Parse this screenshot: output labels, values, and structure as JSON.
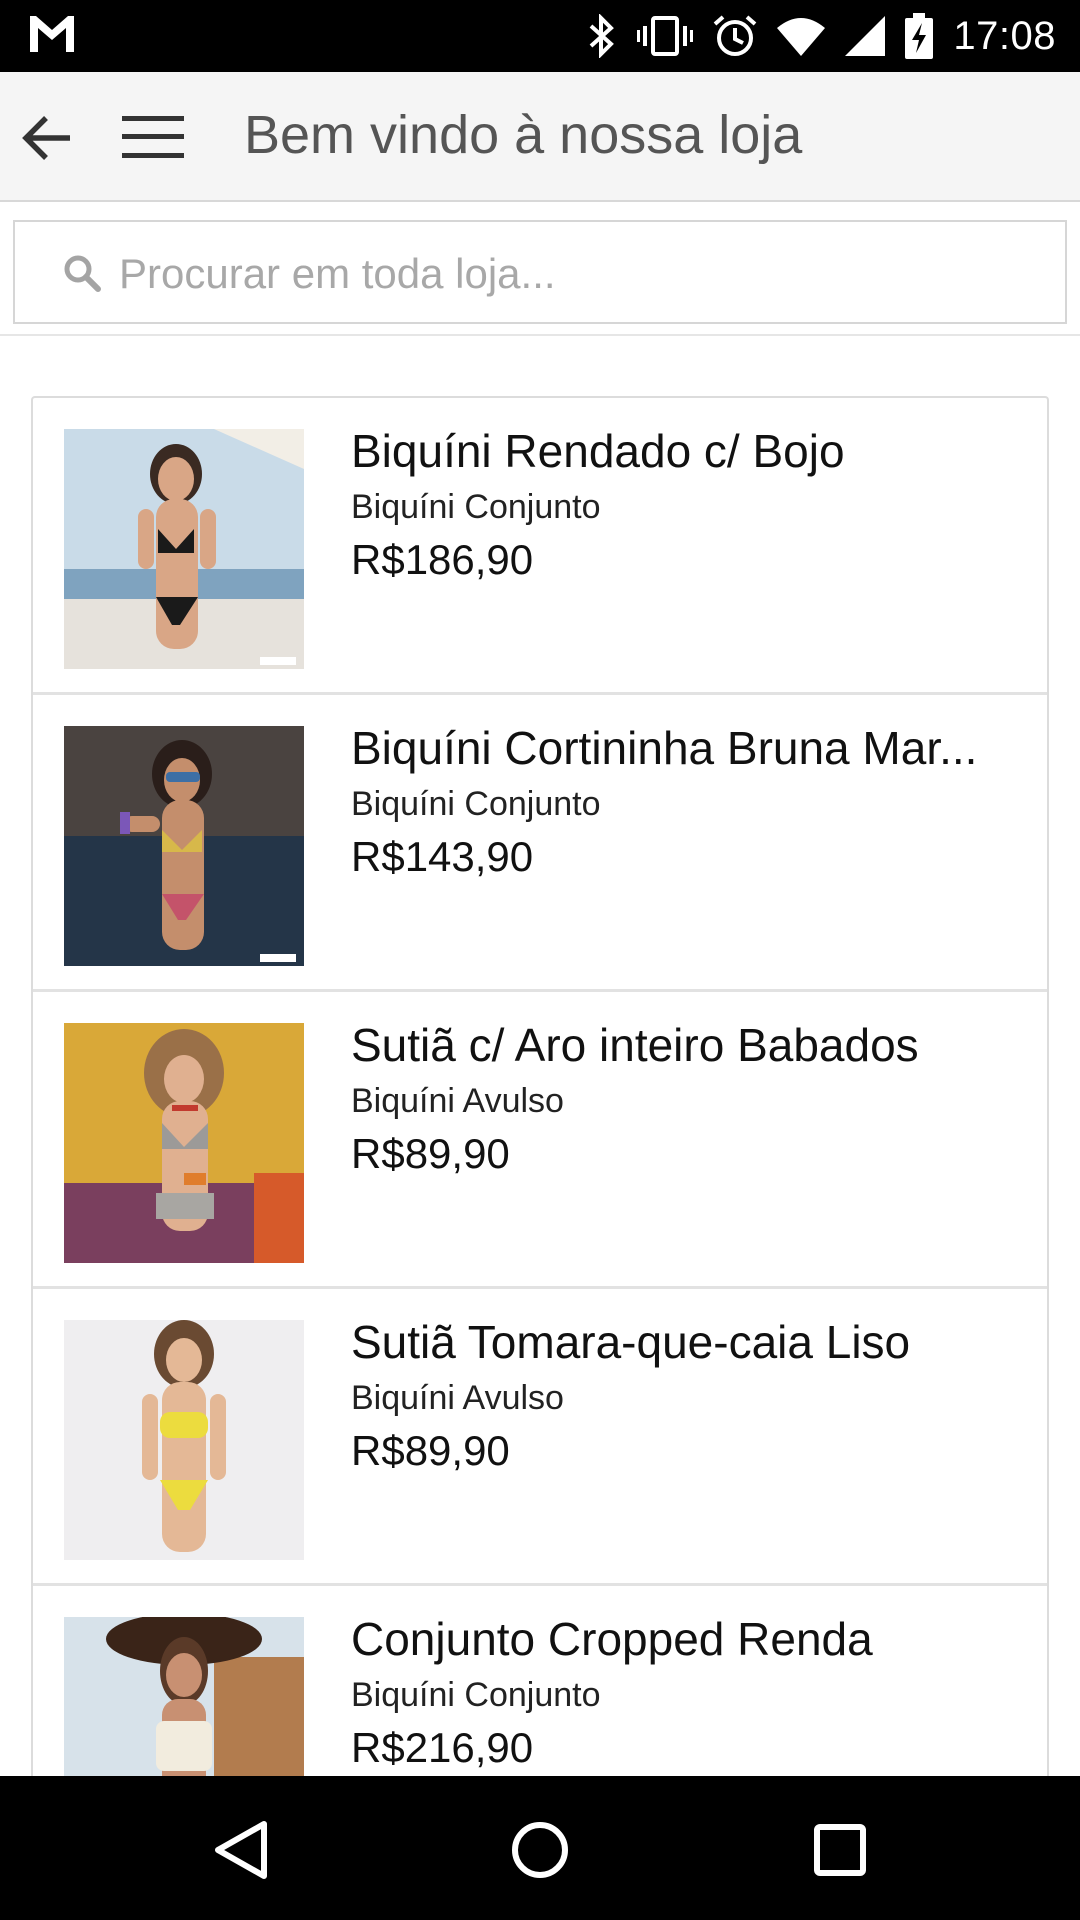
{
  "status_bar": {
    "time": "17:08",
    "icons": [
      "gmail-icon",
      "bluetooth-icon",
      "vibrate-icon",
      "alarm-icon",
      "wifi-icon",
      "signal-icon",
      "battery-charging-icon"
    ]
  },
  "app_bar": {
    "title": "Bem vindo à nossa loja",
    "icons": [
      "back-arrow-icon",
      "hamburger-menu-icon"
    ]
  },
  "search": {
    "placeholder": "Procurar em toda loja..."
  },
  "products": [
    {
      "name": "Biquíni Rendado c/ Bojo",
      "category": "Biquíni Conjunto",
      "price": "R$186,90",
      "image": "product-photo"
    },
    {
      "name": "Biquíni Cortininha Bruna Mar...",
      "category": "Biquíni Conjunto",
      "price": "R$143,90",
      "image": "product-photo"
    },
    {
      "name": "Sutiã c/ Aro inteiro Babados",
      "category": "Biquíni Avulso",
      "price": "R$89,90",
      "image": "product-photo"
    },
    {
      "name": "Sutiã Tomara-que-caia Liso",
      "category": "Biquíni Avulso",
      "price": "R$89,90",
      "image": "product-photo"
    },
    {
      "name": "Conjunto Cropped Renda",
      "category": "Biquíni Conjunto",
      "price": "R$216,90",
      "image": "product-photo"
    }
  ],
  "nav_bar": {
    "icons": [
      "nav-back-icon",
      "nav-home-icon",
      "nav-recents-icon"
    ]
  }
}
